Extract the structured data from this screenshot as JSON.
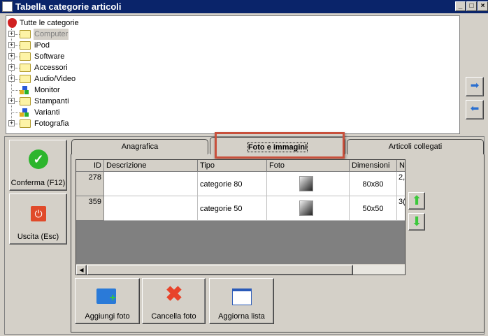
{
  "window": {
    "title": "Tabella categorie articoli",
    "minimize": "_",
    "maximize": "□",
    "close": "×"
  },
  "tree": {
    "root": "Tutte le categorie",
    "items": [
      {
        "label": "Computer",
        "type": "folder",
        "expandable": true,
        "selected": true
      },
      {
        "label": "iPod",
        "type": "folder",
        "expandable": true
      },
      {
        "label": "Software",
        "type": "folder",
        "expandable": true
      },
      {
        "label": "Accessori",
        "type": "folder",
        "expandable": true
      },
      {
        "label": "Audio/Video",
        "type": "folder",
        "expandable": true
      },
      {
        "label": "Monitor",
        "type": "cubes",
        "expandable": false
      },
      {
        "label": "Stampanti",
        "type": "folder",
        "expandable": true
      },
      {
        "label": "Varianti",
        "type": "cubes",
        "expandable": false
      },
      {
        "label": "Fotografia",
        "type": "folder",
        "expandable": true
      }
    ]
  },
  "side_arrows": {
    "right": "➡",
    "left": "⬅"
  },
  "actions": {
    "confirm": "Conferma (F12)",
    "exit": "Uscita (Esc)"
  },
  "tabs": [
    {
      "label": "Anagrafica"
    },
    {
      "label": "Foto e immagini",
      "active": true
    },
    {
      "label": "Articoli collegati"
    }
  ],
  "grid": {
    "columns": [
      "ID",
      "Descrizione",
      "Tipo",
      "Foto",
      "Dimensioni",
      "N"
    ],
    "rows": [
      {
        "id": "278",
        "descrizione": "",
        "tipo": "categorie 80",
        "foto": "image-icon",
        "dimensioni": "80x80",
        "n": "2,"
      },
      {
        "id": "359",
        "descrizione": "",
        "tipo": "categorie 50",
        "foto": "image-icon",
        "dimensioni": "50x50",
        "n": "3("
      }
    ]
  },
  "buttons": {
    "add": "Aggiungi foto",
    "delete": "Cancella foto",
    "refresh": "Aggiorna lista"
  },
  "colors": {
    "title_bar": "#0a246a",
    "highlight": "#c8503c",
    "up_arrow": "#3cc83c"
  }
}
